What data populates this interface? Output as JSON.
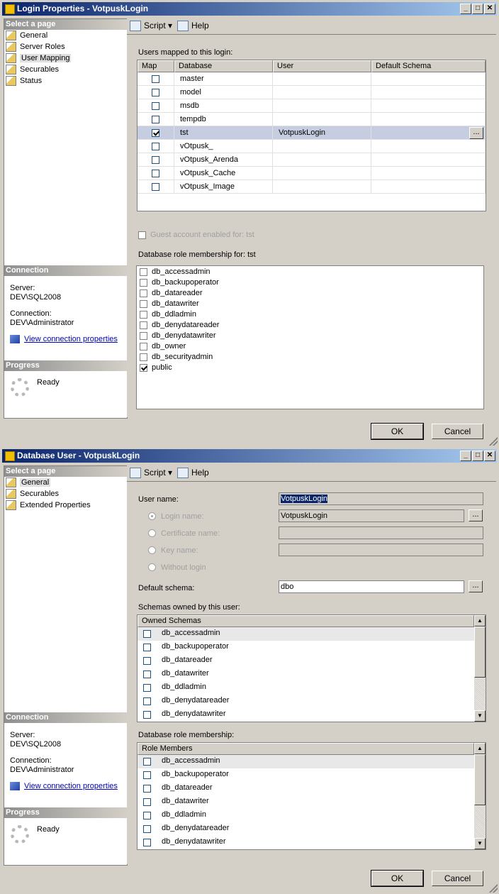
{
  "login_dialog": {
    "title": "Login Properties - VotpuskLogin",
    "select_page_header": "Select a page",
    "pages": [
      "General",
      "Server Roles",
      "User Mapping",
      "Securables",
      "Status"
    ],
    "connection_header": "Connection",
    "server_label": "Server:",
    "server_value": "DEV\\SQL2008",
    "connection_label": "Connection:",
    "connection_value": "DEV\\Administrator",
    "view_connection_link": "View connection properties",
    "progress_header": "Progress",
    "progress_status": "Ready",
    "toolbar": {
      "script": "Script",
      "help": "Help"
    },
    "users_mapped_label": "Users mapped to this login:",
    "mapping_columns": [
      "Map",
      "Database",
      "User",
      "Default Schema"
    ],
    "mapping_rows": [
      {
        "checked": false,
        "database": "master",
        "user": "",
        "schema": ""
      },
      {
        "checked": false,
        "database": "model",
        "user": "",
        "schema": ""
      },
      {
        "checked": false,
        "database": "msdb",
        "user": "",
        "schema": ""
      },
      {
        "checked": false,
        "database": "tempdb",
        "user": "",
        "schema": ""
      },
      {
        "checked": true,
        "database": "tst",
        "user": "VotpuskLogin",
        "schema": ""
      },
      {
        "checked": false,
        "database": "vOtpusk_",
        "user": "",
        "schema": ""
      },
      {
        "checked": false,
        "database": "vOtpusk_Arenda",
        "user": "",
        "schema": ""
      },
      {
        "checked": false,
        "database": "vOtpusk_Cache",
        "user": "",
        "schema": ""
      },
      {
        "checked": false,
        "database": "vOtpusk_Image",
        "user": "",
        "schema": ""
      }
    ],
    "ellipsis": "...",
    "guest_label": "Guest account enabled for: tst",
    "role_membership_label": "Database role membership for: tst",
    "roles": [
      {
        "name": "db_accessadmin",
        "checked": false
      },
      {
        "name": "db_backupoperator",
        "checked": false
      },
      {
        "name": "db_datareader",
        "checked": false
      },
      {
        "name": "db_datawriter",
        "checked": false
      },
      {
        "name": "db_ddladmin",
        "checked": false
      },
      {
        "name": "db_denydatareader",
        "checked": false
      },
      {
        "name": "db_denydatawriter",
        "checked": false
      },
      {
        "name": "db_owner",
        "checked": false
      },
      {
        "name": "db_securityadmin",
        "checked": false
      },
      {
        "name": "public",
        "checked": true
      }
    ],
    "ok": "OK",
    "cancel": "Cancel"
  },
  "user_dialog": {
    "title": "Database User - VotpuskLogin",
    "select_page_header": "Select a page",
    "pages": [
      "General",
      "Securables",
      "Extended Properties"
    ],
    "connection_header": "Connection",
    "server_label": "Server:",
    "server_value": "DEV\\SQL2008",
    "connection_label": "Connection:",
    "connection_value": "DEV\\Administrator",
    "view_connection_link": "View connection properties",
    "progress_header": "Progress",
    "progress_status": "Ready",
    "toolbar": {
      "script": "Script",
      "help": "Help"
    },
    "user_name_label": "User name:",
    "user_name_value": "VotpuskLogin",
    "login_name_label": "Login name:",
    "login_name_value": "VotpuskLogin",
    "certificate_name_label": "Certificate name:",
    "key_name_label": "Key name:",
    "without_login_label": "Without login",
    "default_schema_label": "Default schema:",
    "default_schema_value": "dbo",
    "ellipsis": "...",
    "schemas_owned_label": "Schemas owned by this user:",
    "owned_schemas_header": "Owned Schemas",
    "owned_schemas": [
      "db_accessadmin",
      "db_backupoperator",
      "db_datareader",
      "db_datawriter",
      "db_ddladmin",
      "db_denydatareader",
      "db_denydatawriter"
    ],
    "role_membership_label": "Database role membership:",
    "role_members_header": "Role Members",
    "role_members": [
      "db_accessadmin",
      "db_backupoperator",
      "db_datareader",
      "db_datawriter",
      "db_ddladmin",
      "db_denydatareader",
      "db_denydatawriter"
    ],
    "ok": "OK",
    "cancel": "Cancel"
  }
}
